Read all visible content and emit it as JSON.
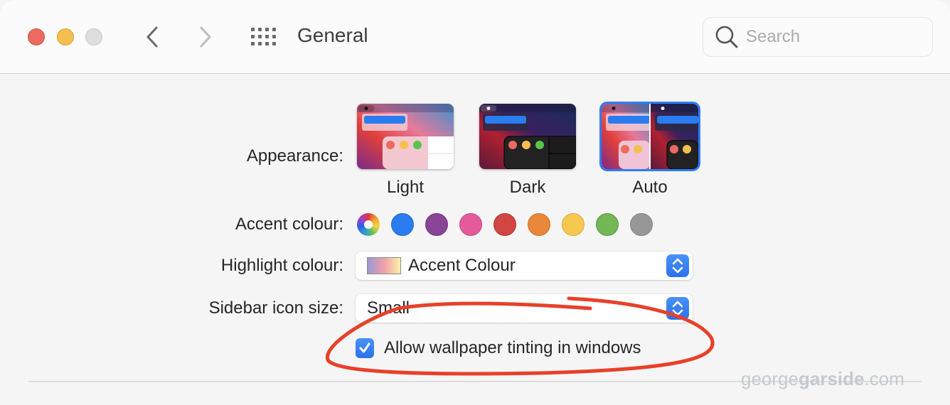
{
  "window": {
    "title": "General",
    "traffic_lights": [
      "close",
      "minimize",
      "zoom-disabled"
    ],
    "nav": {
      "back_icon": "chevron-left-icon",
      "forward_icon": "chevron-right-icon",
      "grid_icon": "grid-icon"
    }
  },
  "search": {
    "placeholder": "Search",
    "value": ""
  },
  "appearance": {
    "label": "Appearance:",
    "options": [
      {
        "name": "Light",
        "selected": false
      },
      {
        "name": "Dark",
        "selected": false
      },
      {
        "name": "Auto",
        "selected": true
      }
    ]
  },
  "accent": {
    "label": "Accent colour:",
    "colors": [
      {
        "name": "multicolour",
        "hex": "multicolor",
        "selected": true
      },
      {
        "name": "blue",
        "hex": "#2a7cf0"
      },
      {
        "name": "purple",
        "hex": "#8a4596"
      },
      {
        "name": "pink",
        "hex": "#e35b9b"
      },
      {
        "name": "red",
        "hex": "#d14543"
      },
      {
        "name": "orange",
        "hex": "#e9883a"
      },
      {
        "name": "yellow",
        "hex": "#f7c84f"
      },
      {
        "name": "green",
        "hex": "#74b755"
      },
      {
        "name": "graphite",
        "hex": "#989898"
      }
    ]
  },
  "highlight": {
    "label": "Highlight colour:",
    "value": "Accent Colour"
  },
  "sidebar_icon_size": {
    "label": "Sidebar icon size:",
    "value": "Small"
  },
  "wallpaper_tinting": {
    "label": "Allow wallpaper tinting in windows",
    "checked": true
  },
  "watermark": {
    "prefix": "george",
    "bold": "garside",
    "suffix": ".com"
  },
  "colors": {
    "accent": "#2f7cf6",
    "annotation": "#e8402a"
  }
}
